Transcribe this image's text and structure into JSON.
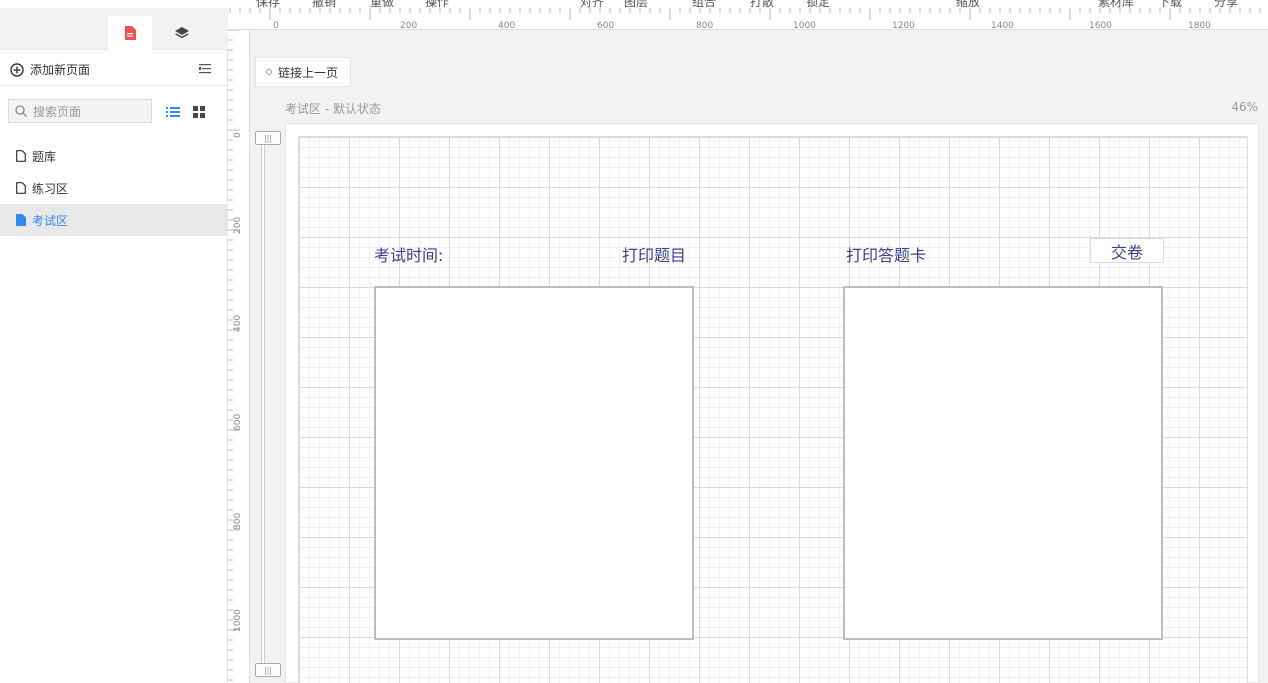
{
  "toolbar": {
    "items": [
      "保存",
      "撤销",
      "重做",
      "操作",
      "对齐",
      "图层",
      "组合",
      "打散",
      "锁定",
      "缩放",
      "素材库",
      "下载",
      "分享"
    ]
  },
  "sidebar": {
    "tabs": [
      {
        "icon": "page-icon",
        "active": true
      },
      {
        "icon": "layers-icon",
        "active": false
      }
    ],
    "add_page_label": "添加新页面",
    "search_placeholder": "搜索页面",
    "pages": [
      {
        "label": "题库",
        "active": false
      },
      {
        "label": "练习区",
        "active": false
      },
      {
        "label": "考试区",
        "active": true
      }
    ]
  },
  "ruler": {
    "top_labels": [
      "0",
      "200",
      "400",
      "600",
      "800",
      "1000",
      "1200",
      "1400",
      "1600",
      "1800"
    ],
    "left_labels": [
      "0",
      "200",
      "400",
      "600",
      "800",
      "1000"
    ]
  },
  "canvas": {
    "link_chip_label": "链接上一页",
    "title": "考试区 - 默认状态",
    "zoom": "46%",
    "exam_time_label": "考试时间:",
    "print_questions_label": "打印题目",
    "print_answer_card_label": "打印答题卡",
    "submit_label": "交卷"
  },
  "colors": {
    "accent": "#2d8cf0",
    "widget_text": "#3a3f8f",
    "page_icon": "#f0504f"
  }
}
